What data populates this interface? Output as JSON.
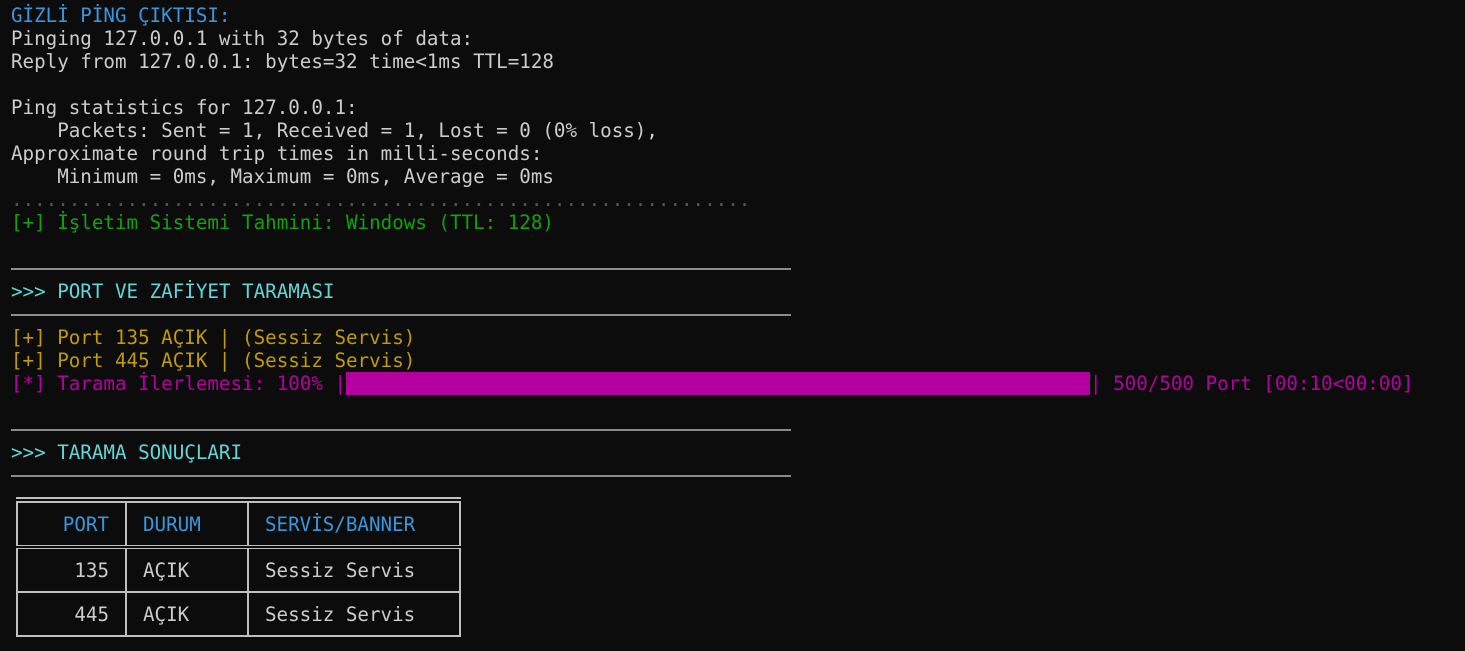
{
  "terminal": {
    "ping_header": "GİZLİ PİNG ÇIKTISI:",
    "ping_lines": [
      "Pinging 127.0.0.1 with 32 bytes of data:",
      "Reply from 127.0.0.1: bytes=32 time<1ms TTL=128",
      "",
      "Ping statistics for 127.0.0.1:",
      "    Packets: Sent = 1, Received = 1, Lost = 0 (0% loss),",
      "Approximate round trip times in milli-seconds:",
      "    Minimum = 0ms, Maximum = 0ms, Average = 0ms"
    ],
    "dots": "................................................................",
    "os_guess": "[+] İşletim Sistemi Tahmini: Windows (TTL: 128)",
    "port_section_title": ">>> PORT VE ZAFİYET TARAMASI",
    "open_ports": [
      "[+] Port 135 AÇIK | (Sessiz Servis)",
      "[+] Port 445 AÇIK | (Sessiz Servis)"
    ],
    "progress": {
      "label": "[*] Tarama İlerlemesi: 100% |",
      "percent": 100,
      "suffix": "| 500/500 Port [00:10<00:00]"
    },
    "results_section_title": ">>> TARAMA SONUÇLARI",
    "results_table": {
      "headers": [
        "PORT",
        "DURUM",
        "SERVİS/BANNER"
      ],
      "rows": [
        [
          "135",
          "AÇIK",
          "Sessiz Servis"
        ],
        [
          "445",
          "AÇIK",
          "Sessiz Servis"
        ]
      ]
    }
  },
  "colors": {
    "background": "#0c0c0c",
    "text": "#cccccc",
    "header_blue": "#3a96dd",
    "section_teal": "#61d6d6",
    "success_green": "#13a10e",
    "port_yellow": "#c19c00",
    "progress_magenta": "#b4009e"
  }
}
